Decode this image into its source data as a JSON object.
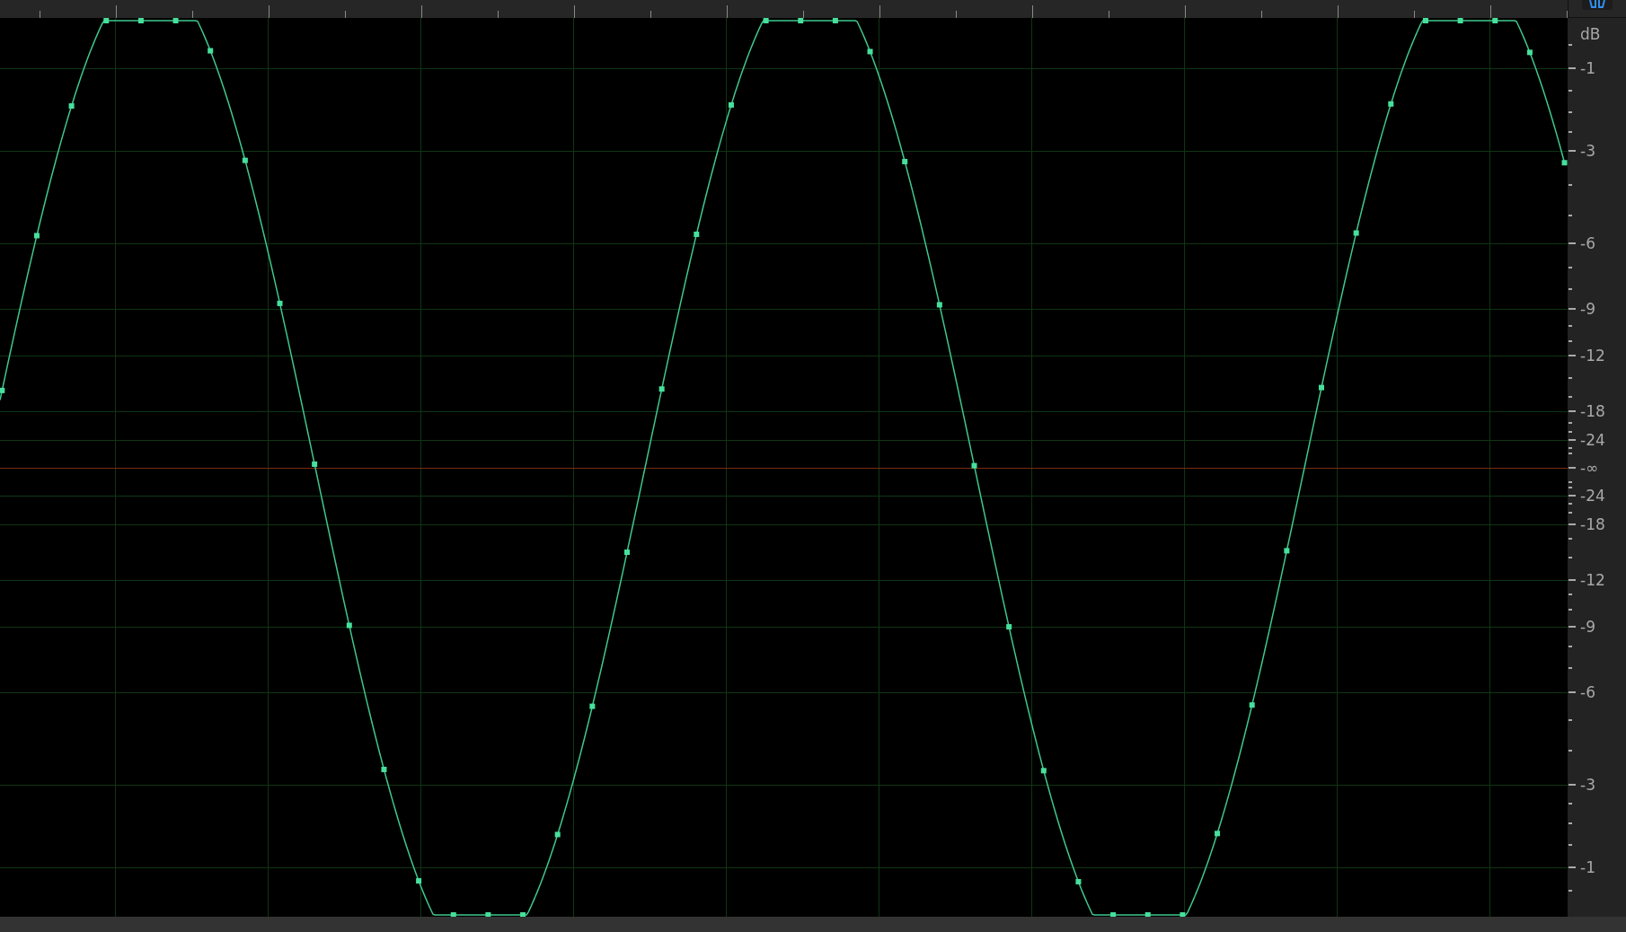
{
  "amplitude_ruler": {
    "unit": "dB",
    "labels": [
      "-1",
      "-3",
      "-6",
      "-9",
      "-12",
      "-18",
      "-24",
      "-∞",
      "-24",
      "-18",
      "-12",
      "-9",
      "-6",
      "-3",
      "-1"
    ]
  }
}
